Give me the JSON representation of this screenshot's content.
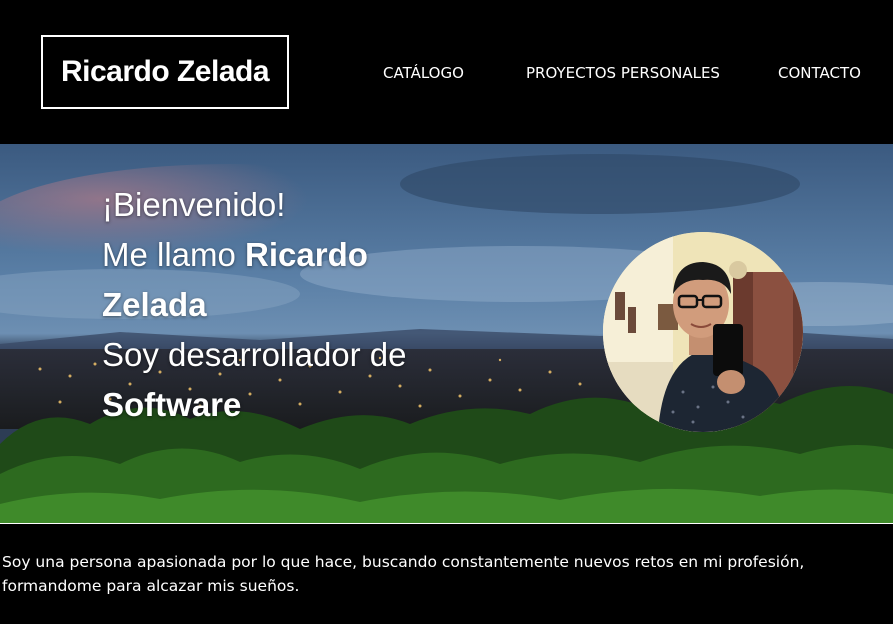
{
  "header": {
    "logo_text": "Ricardo Zelada",
    "nav": [
      {
        "label": "CATÁLOGO"
      },
      {
        "label": "PROYECTOS PERSONALES"
      },
      {
        "label": "CONTACTO"
      }
    ]
  },
  "hero": {
    "greeting": "¡Bienvenido!",
    "intro_prefix": "Me llamo ",
    "name_first": "Ricardo",
    "name_last": "Zelada",
    "role_prefix": "Soy desarrollador de",
    "role": "Software"
  },
  "about": {
    "text": "Soy una persona apasionada por lo que hace, buscando constantemente nuevos retos en mi profesión, formandome para alcazar mis sueños."
  },
  "colors": {
    "background": "#000000",
    "text": "#ffffff"
  }
}
